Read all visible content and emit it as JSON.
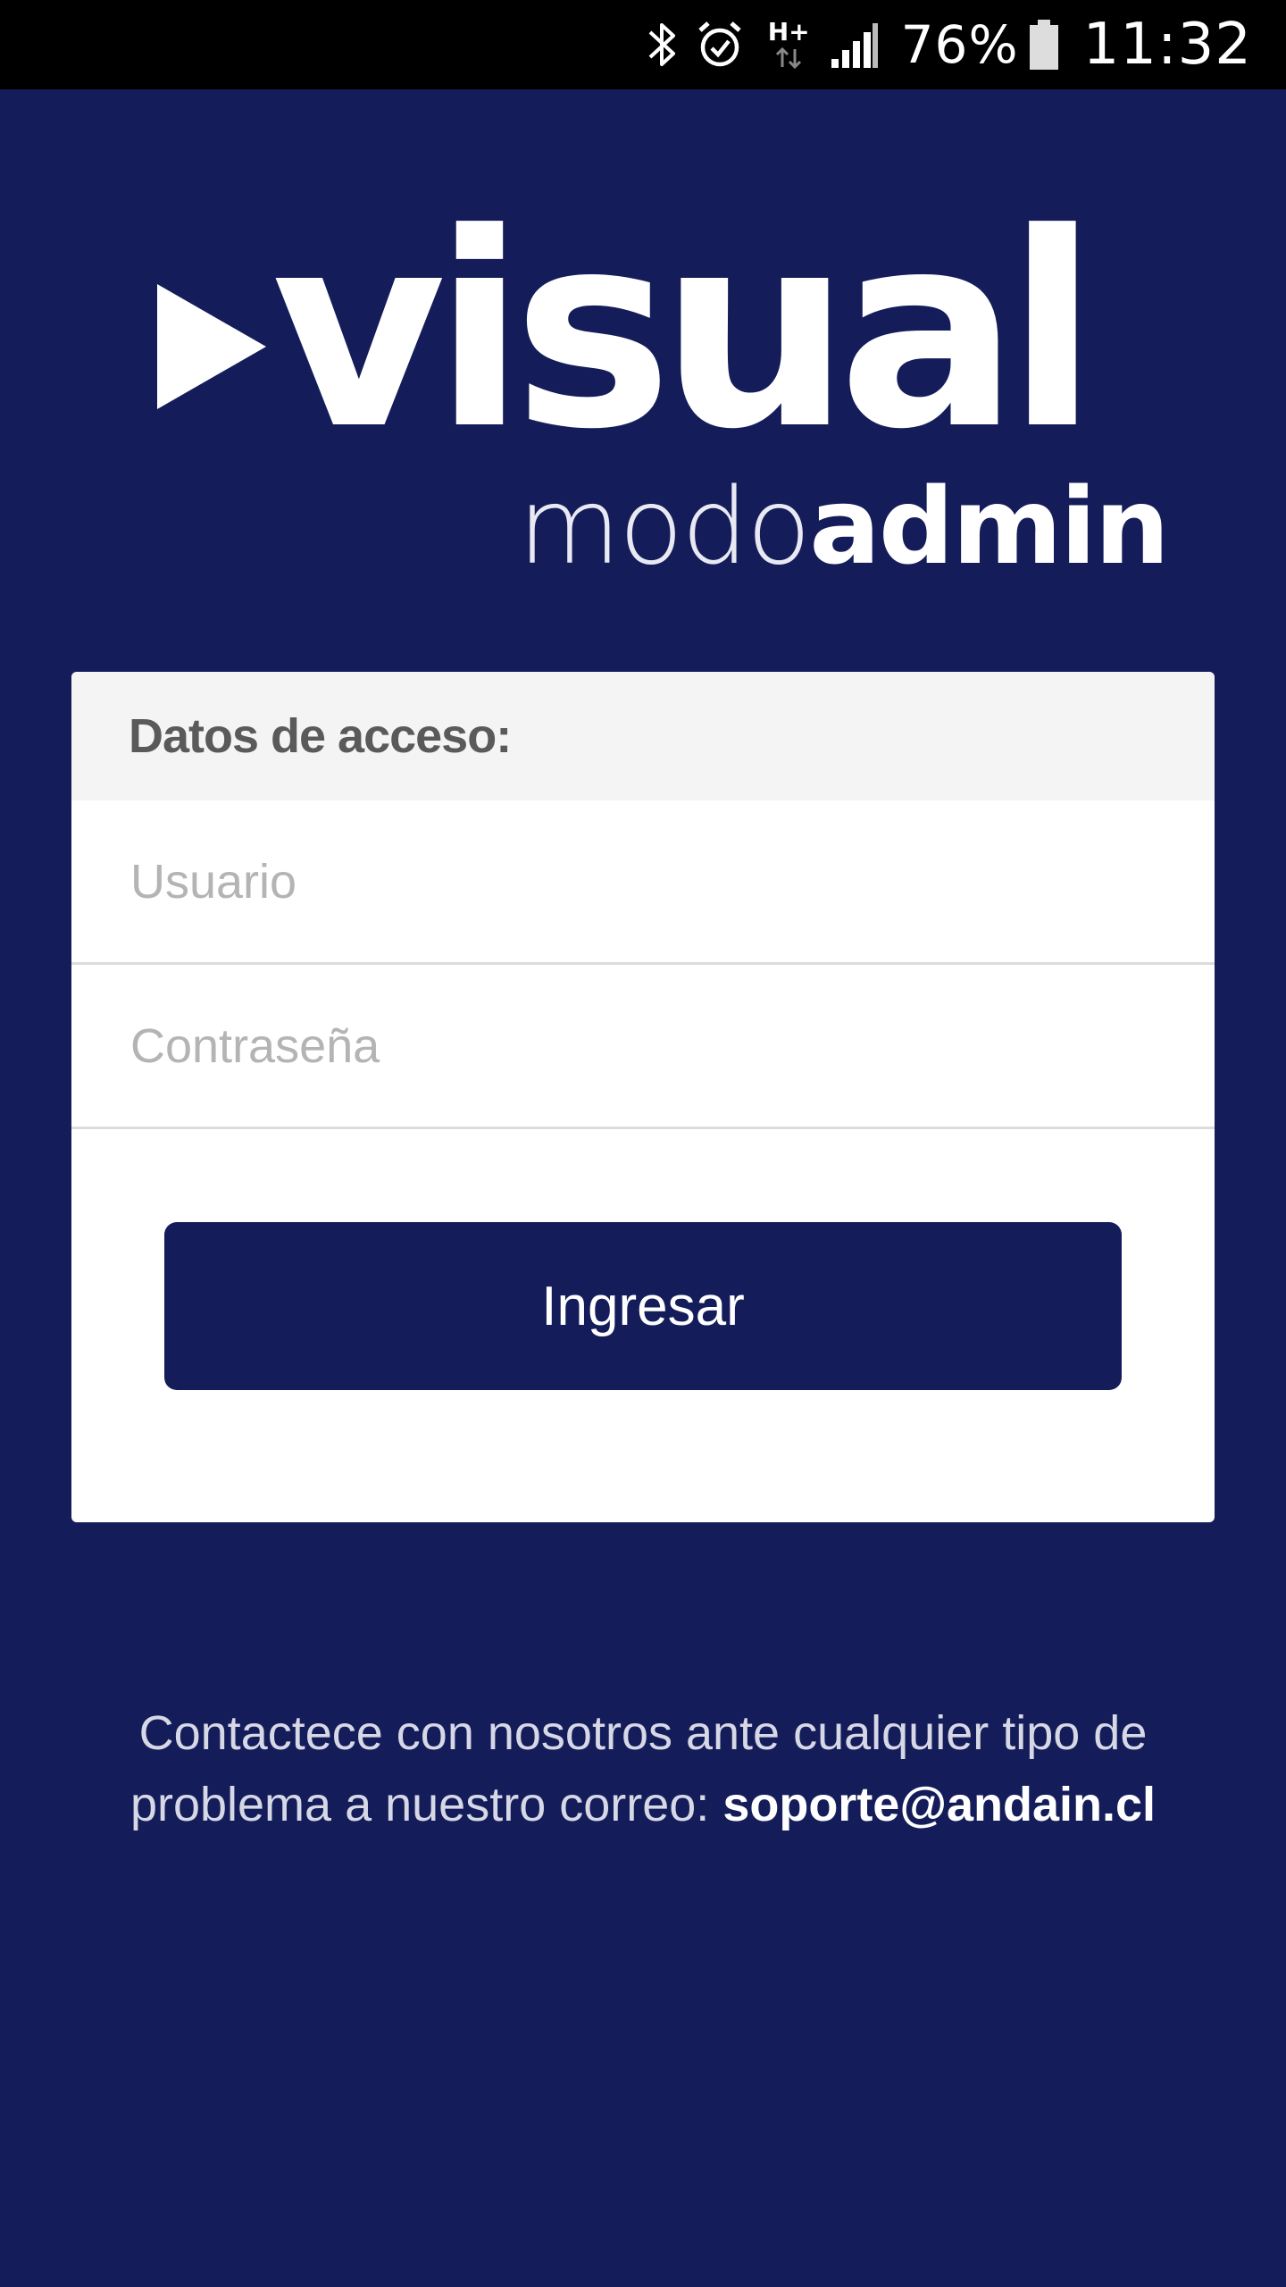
{
  "status_bar": {
    "battery_text": "76%",
    "time": "11:32",
    "network_label": "H+",
    "icons": [
      "bluetooth-icon",
      "alarm-icon",
      "network-h-plus-icon",
      "signal-icon",
      "battery-icon"
    ]
  },
  "logo": {
    "word": "visual",
    "sub_light": "modo",
    "sub_bold": "admin"
  },
  "login_card": {
    "header": "Datos de acceso:",
    "username_placeholder": "Usuario",
    "username_value": "",
    "password_placeholder": "Contraseña",
    "password_value": "",
    "submit_label": "Ingresar"
  },
  "footer": {
    "contact_text": "Contactece con nosotros ante cualquier tipo de problema a nuestro correo:",
    "email": "soporte@andain.cl"
  },
  "colors": {
    "background": "#141d5a",
    "button": "#141d5a",
    "card_header": "#f4f4f4"
  }
}
